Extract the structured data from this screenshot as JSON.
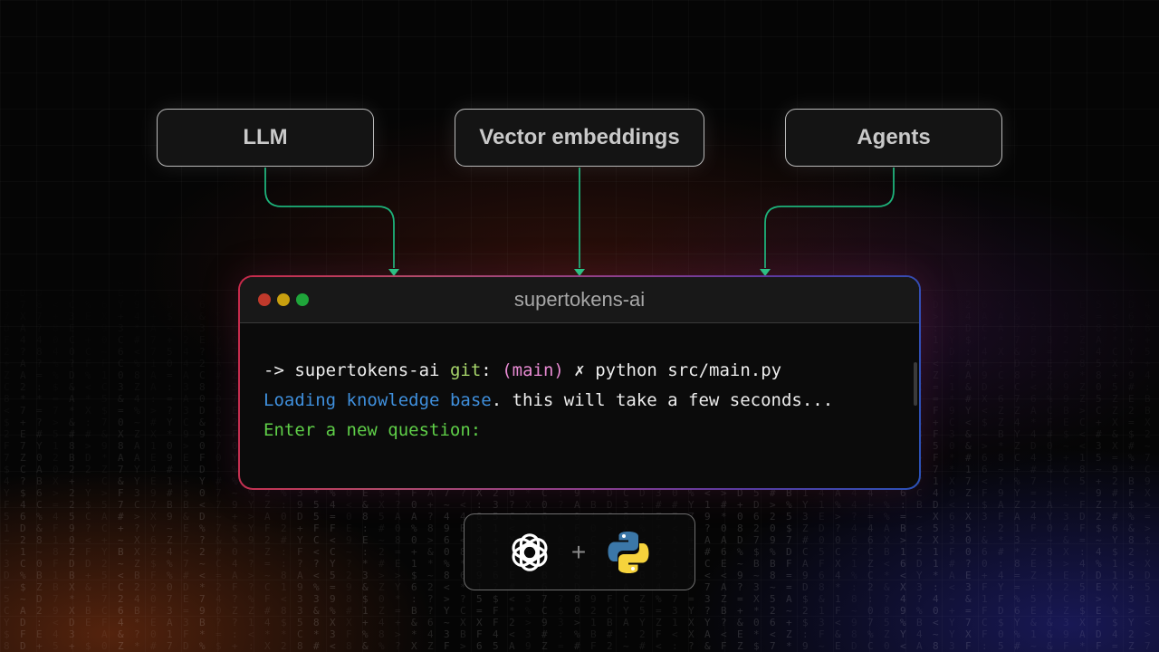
{
  "nodes": {
    "llm": "LLM",
    "vector": "Vector embeddings",
    "agents": "Agents"
  },
  "terminal": {
    "title": "supertokens-ai",
    "line1": {
      "arrow": "->",
      "dir": "supertokens-ai",
      "git": "git",
      "colon": ":",
      "branch": "(main)",
      "mark": "✗",
      "command": "python src/main.py"
    },
    "line2": {
      "loading": "Loading",
      "knowledge": "knowledge",
      "base": "base",
      "rest": ". this will take a few seconds..."
    },
    "line3": "Enter a new question:"
  },
  "logos": {
    "left": "openai-logo",
    "plus": "+",
    "right": "python-logo"
  },
  "colors": {
    "connector": "#1db27a",
    "arrowhead": "#22d38a",
    "border_start": "#c8294a",
    "border_end": "#2a52b8"
  }
}
